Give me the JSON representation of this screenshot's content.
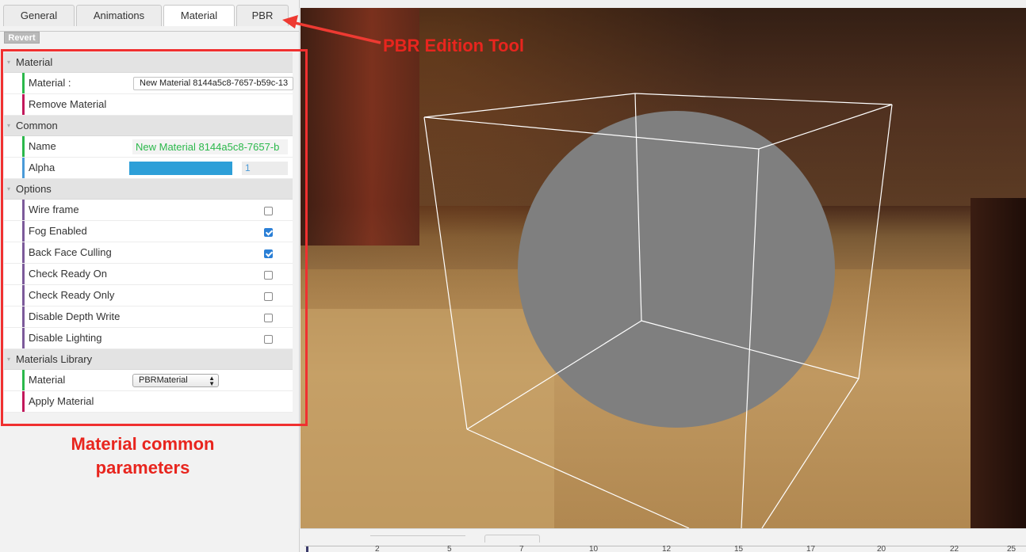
{
  "tabs": [
    {
      "label": "General",
      "active": false
    },
    {
      "label": "Animations",
      "active": false
    },
    {
      "label": "Material",
      "active": true
    },
    {
      "label": "PBR",
      "active": false
    }
  ],
  "revert_label": "Revert",
  "groups": {
    "material": {
      "header": "Material",
      "material_label": "Material :",
      "material_value": "New Material 8144a5c8-7657-b59c-13",
      "remove_label": "Remove Material"
    },
    "common": {
      "header": "Common",
      "name_label": "Name",
      "name_value": "New Material 8144a5c8-7657-b",
      "alpha_label": "Alpha",
      "alpha_value": "1"
    },
    "options": {
      "header": "Options",
      "items": [
        {
          "label": "Wire frame",
          "checked": false
        },
        {
          "label": "Fog Enabled",
          "checked": true
        },
        {
          "label": "Back Face Culling",
          "checked": true
        },
        {
          "label": "Check Ready On",
          "checked": false
        },
        {
          "label": "Check Ready Only",
          "checked": false
        },
        {
          "label": "Disable Depth Write",
          "checked": false
        },
        {
          "label": "Disable Lighting",
          "checked": false
        }
      ]
    },
    "library": {
      "header": "Materials Library",
      "material_label": "Material",
      "material_select": "PBRMaterial",
      "apply_label": "Apply Material"
    }
  },
  "annotations": {
    "pbr_tool": "PBR Edition Tool",
    "common_params_line1": "Material common",
    "common_params_line2": "parameters"
  },
  "timeline_ticks": [
    "2",
    "5",
    "7",
    "10",
    "12",
    "15",
    "17",
    "20",
    "22",
    "25"
  ],
  "colors": {
    "annotation_red": "#e8251e",
    "alpha_slider": "#2d9fd8",
    "name_text": "#2bb84b",
    "checkbox_checked": "#2a7fd6",
    "sphere": "#7f7f7f",
    "wireframe": "#ffffff"
  }
}
